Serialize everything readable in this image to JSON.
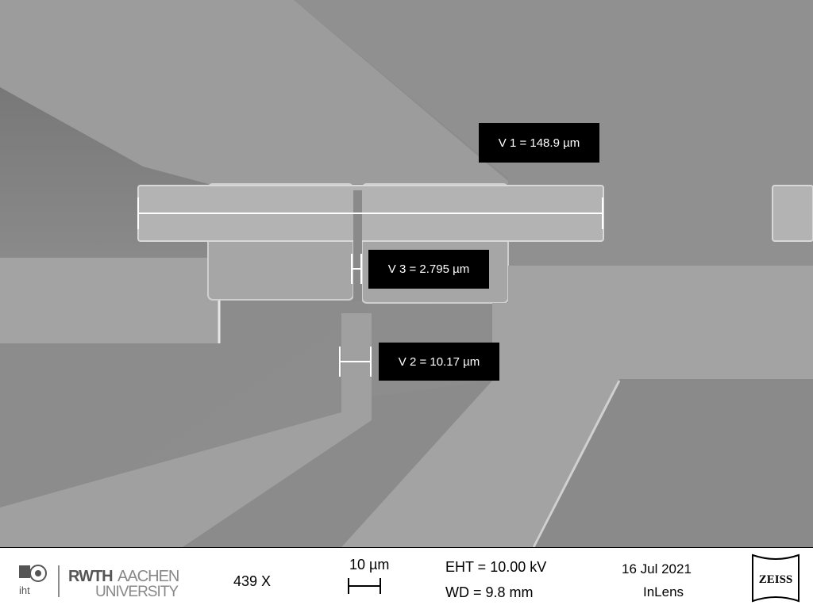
{
  "measurements": {
    "v1": "V 1 = 148.9 µm",
    "v2": "V 2 = 10.17 µm",
    "v3": "V 3 = 2.795 µm"
  },
  "info_bar": {
    "magnification": "439 X",
    "scale_bar_label": "10 µm",
    "eht": "EHT = 10.00 kV",
    "wd": "WD =  9.8 mm",
    "date": "16 Jul 2021",
    "detector": "InLens"
  },
  "logos": {
    "iht": "iht",
    "rwth_bold": "RWTH",
    "rwth_light": "AACHEN",
    "rwth_sub": "UNIVERSITY",
    "zeiss": "ZEISS"
  },
  "icons": [
    "iht-logo-icon",
    "rwth-logo-icon",
    "zeiss-logo-icon"
  ],
  "colors": {
    "background": "#8c8c8c",
    "label_bg": "#000000",
    "label_text": "#ffffff",
    "info_bar": "#ffffff"
  }
}
